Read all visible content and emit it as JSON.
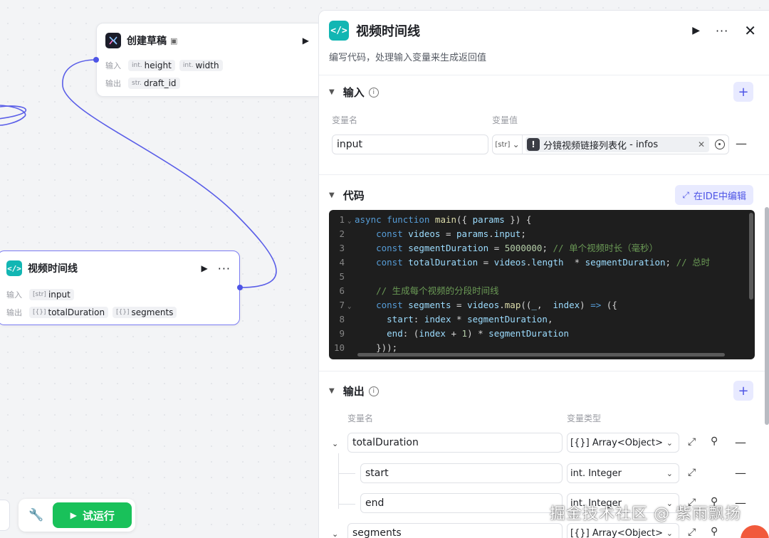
{
  "canvas": {
    "nodes": {
      "draft": {
        "title": "创建草稿",
        "input_label": "输入",
        "output_label": "输出",
        "inputs": [
          {
            "type": "int.",
            "name": "height"
          },
          {
            "type": "int.",
            "name": "width"
          }
        ],
        "outputs": [
          {
            "type": "str.",
            "name": "draft_id"
          }
        ]
      },
      "timeline": {
        "title": "视频时间线",
        "input_label": "输入",
        "output_label": "输出",
        "inputs": [
          {
            "type": "[str]",
            "name": "input"
          }
        ],
        "outputs": [
          {
            "type": "[{}]",
            "name": "totalDuration"
          },
          {
            "type": "[{}]",
            "name": "segments"
          }
        ]
      }
    },
    "toolbar": {
      "run_label": "试运行"
    }
  },
  "panel": {
    "title": "视频时间线",
    "description": "编写代码，处理输入变量来生成返回值",
    "input_section": {
      "title": "输入",
      "col_name": "变量名",
      "col_value": "变量值",
      "rows": [
        {
          "name": "input",
          "type": "[str]",
          "ref_node": "分镜视频链接列表化",
          "ref_sep": " - ",
          "ref_field": "infos"
        }
      ]
    },
    "code_section": {
      "title": "代码",
      "ide_label": "在IDE中编辑"
    },
    "output_section": {
      "title": "输出",
      "col_name": "变量名",
      "col_type": "变量类型",
      "rows": [
        {
          "name": "totalDuration",
          "type": "[{}] Array<Object>"
        },
        {
          "name": "start",
          "type": "int. Integer"
        },
        {
          "name": "end",
          "type": "int. Integer"
        },
        {
          "name": "segments",
          "type": "[{}] Array<Object>"
        }
      ]
    }
  },
  "code": {
    "lines": [
      "async function main({ params }) {",
      "    const videos = params.input;",
      "    const segmentDuration = 5000000; // 单个视频时长（毫秒）",
      "    const totalDuration = videos.length  * segmentDuration; // 总时",
      "",
      "    // 生成每个视频的分段时间线",
      "    const segments = videos.map((_,  index) => ({",
      "      start: index * segmentDuration,",
      "      end: (index + 1) * segmentDuration",
      "    }));"
    ],
    "line_numbers": [
      "1",
      "2",
      "3",
      "4",
      "5",
      "6",
      "7",
      "8",
      "9",
      "10"
    ]
  },
  "watermark": "掘金技术社区 @ 紫雨飘扬",
  "colors": {
    "accent": "#4e55e6",
    "run_green": "#19c15a",
    "code_icon": "#12b6b3",
    "editor_bg": "#1e1e1e"
  }
}
